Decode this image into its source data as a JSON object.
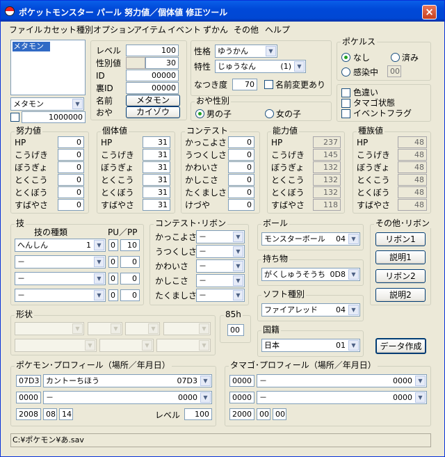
{
  "window": {
    "title": "ポケットモンスター パール 努力値／個体値 修正ツール",
    "close": "×"
  },
  "menu": [
    "ファイル",
    "カセット種別",
    "オプション",
    "アイテム",
    "イベント",
    "ずかん",
    "その他",
    "ヘルプ"
  ],
  "left": {
    "list_selected": "メタモン",
    "species": "メタモン",
    "exp": "1000000"
  },
  "info": {
    "level_label": "レベル",
    "level": "100",
    "seibetsu_label": "性別値",
    "seibetsu": "30",
    "id_label": "ID",
    "id": "00000",
    "uraid_label": "裏ID",
    "uraid": "00000",
    "name_label": "名前",
    "name": "メタモン",
    "oya_label": "おや",
    "oya": "カイゾウ"
  },
  "nature": {
    "label": "性格",
    "value": "ゆうかん",
    "ability_label": "特性",
    "ability": "じゅうなん",
    "ability_num": "(1)",
    "natsuki_label": "なつき度",
    "natsuki": "70",
    "rename_label": "名前変更あり"
  },
  "oyasex": {
    "title": "おや性別",
    "male": "男の子",
    "female": "女の子"
  },
  "pokerus": {
    "title": "ポケルス",
    "none": "なし",
    "done": "済み",
    "infected": "感染中",
    "days": "00"
  },
  "flags": {
    "shiny": "色違い",
    "egg": "タマゴ状態",
    "event": "イベントフラグ"
  },
  "stat_labels": [
    "HP",
    "こうげき",
    "ぼうぎょ",
    "とくこう",
    "とくぼう",
    "すばやさ"
  ],
  "effort": {
    "title": "努力値",
    "values": [
      "0",
      "0",
      "0",
      "0",
      "0",
      "0"
    ]
  },
  "iv": {
    "title": "個体値",
    "values": [
      "31",
      "31",
      "31",
      "31",
      "31",
      "31"
    ]
  },
  "contest": {
    "title": "コンテスト",
    "labels": [
      "かっこよさ",
      "うつくしさ",
      "かわいさ",
      "かしこさ",
      "たくましさ",
      "けづや"
    ],
    "values": [
      "0",
      "0",
      "0",
      "0",
      "0",
      "0"
    ]
  },
  "ability_stats": {
    "title": "能力値",
    "values": [
      "237",
      "145",
      "132",
      "132",
      "132",
      "118"
    ]
  },
  "base": {
    "title": "種族値",
    "values": [
      "48",
      "48",
      "48",
      "48",
      "48",
      "48"
    ]
  },
  "moves": {
    "title": "技",
    "type_label": "技の種類",
    "pupp_label": "PU／PP",
    "list": [
      {
        "name": "へんしん",
        "num": "1",
        "pu": "0",
        "pp": "10"
      },
      {
        "name": "－",
        "num": "",
        "pu": "0",
        "pp": "0"
      },
      {
        "name": "－",
        "num": "",
        "pu": "0",
        "pp": "0"
      },
      {
        "name": "－",
        "num": "",
        "pu": "0",
        "pp": "0"
      }
    ]
  },
  "contest_ribbon": {
    "title": "コンテスト･リボン",
    "labels": [
      "かっこよさ",
      "うつくしさ",
      "かわいさ",
      "かしこさ",
      "たくましさ"
    ],
    "values": [
      "－",
      "－",
      "－",
      "－",
      "－"
    ]
  },
  "ball": {
    "title": "ボール",
    "value": "モンスターボール",
    "num": "04"
  },
  "held": {
    "title": "持ち物",
    "value": "がくしゅうそうち",
    "num": "0D8"
  },
  "soft": {
    "title": "ソフト種別",
    "value": "ファイアレッド",
    "num": "04"
  },
  "country": {
    "title": "国籍",
    "value": "日本",
    "num": "01"
  },
  "other_ribbon": {
    "title": "その他･リボン",
    "ribbon1": "リボン1",
    "desc1": "説明1",
    "ribbon2": "リボン2",
    "desc2": "説明2"
  },
  "form": {
    "title": "形状"
  },
  "h85": {
    "title": "85h",
    "value": "00"
  },
  "create_button": "データ作成",
  "pokemon_profile": {
    "title": "ポケモン･プロフィール（場所／年月日）",
    "code": "07D3",
    "place": "カントーちほう",
    "place_code": "07D3",
    "code2": "0000",
    "place2": "－",
    "place2_code": "0000",
    "year": "2008",
    "month": "08",
    "day": "14",
    "level_label": "レベル",
    "level": "100"
  },
  "egg_profile": {
    "title": "タマゴ･プロフィール（場所／年月日）",
    "code": "0000",
    "place": "－",
    "place_code": "0000",
    "code2": "0000",
    "place2": "－",
    "place2_code": "0000",
    "year": "2000",
    "month": "00",
    "day": "00"
  },
  "status": "C:¥ポケモン¥あ.sav"
}
